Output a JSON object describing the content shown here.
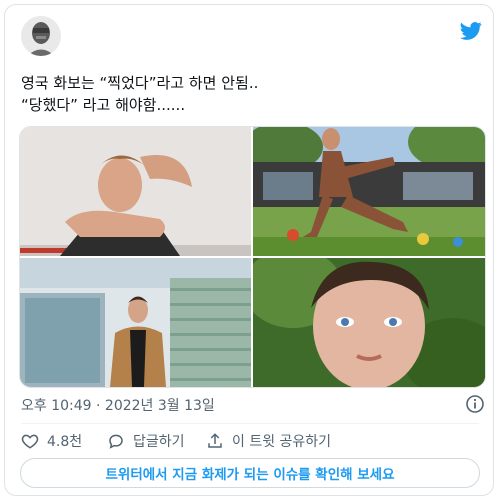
{
  "tweet": {
    "text_lines": [
      "영국 화보는 “찍었다”라고 하면 안됨..",
      "“당했다” 라고 해야함......"
    ],
    "meta": {
      "time": "오후 10:49",
      "separator": " · ",
      "date": "2022년 3월 13일"
    },
    "actions": {
      "likes": "4.8천",
      "reply": "답글하기",
      "share": "이 트윗 공유하기"
    },
    "more_button": "트위터에서 지금 화제가 되는 이슈를 확인해 보세요"
  },
  "icons": {
    "brand": "twitter-bird-icon",
    "info": "info-icon",
    "like": "heart-icon",
    "reply": "speech-bubble-icon",
    "share": "share-upload-icon"
  },
  "colors": {
    "twitter_blue": "#1d9bf0",
    "secondary_text": "#536471",
    "primary_text": "#0f1419",
    "border": "#dfe3e6"
  }
}
